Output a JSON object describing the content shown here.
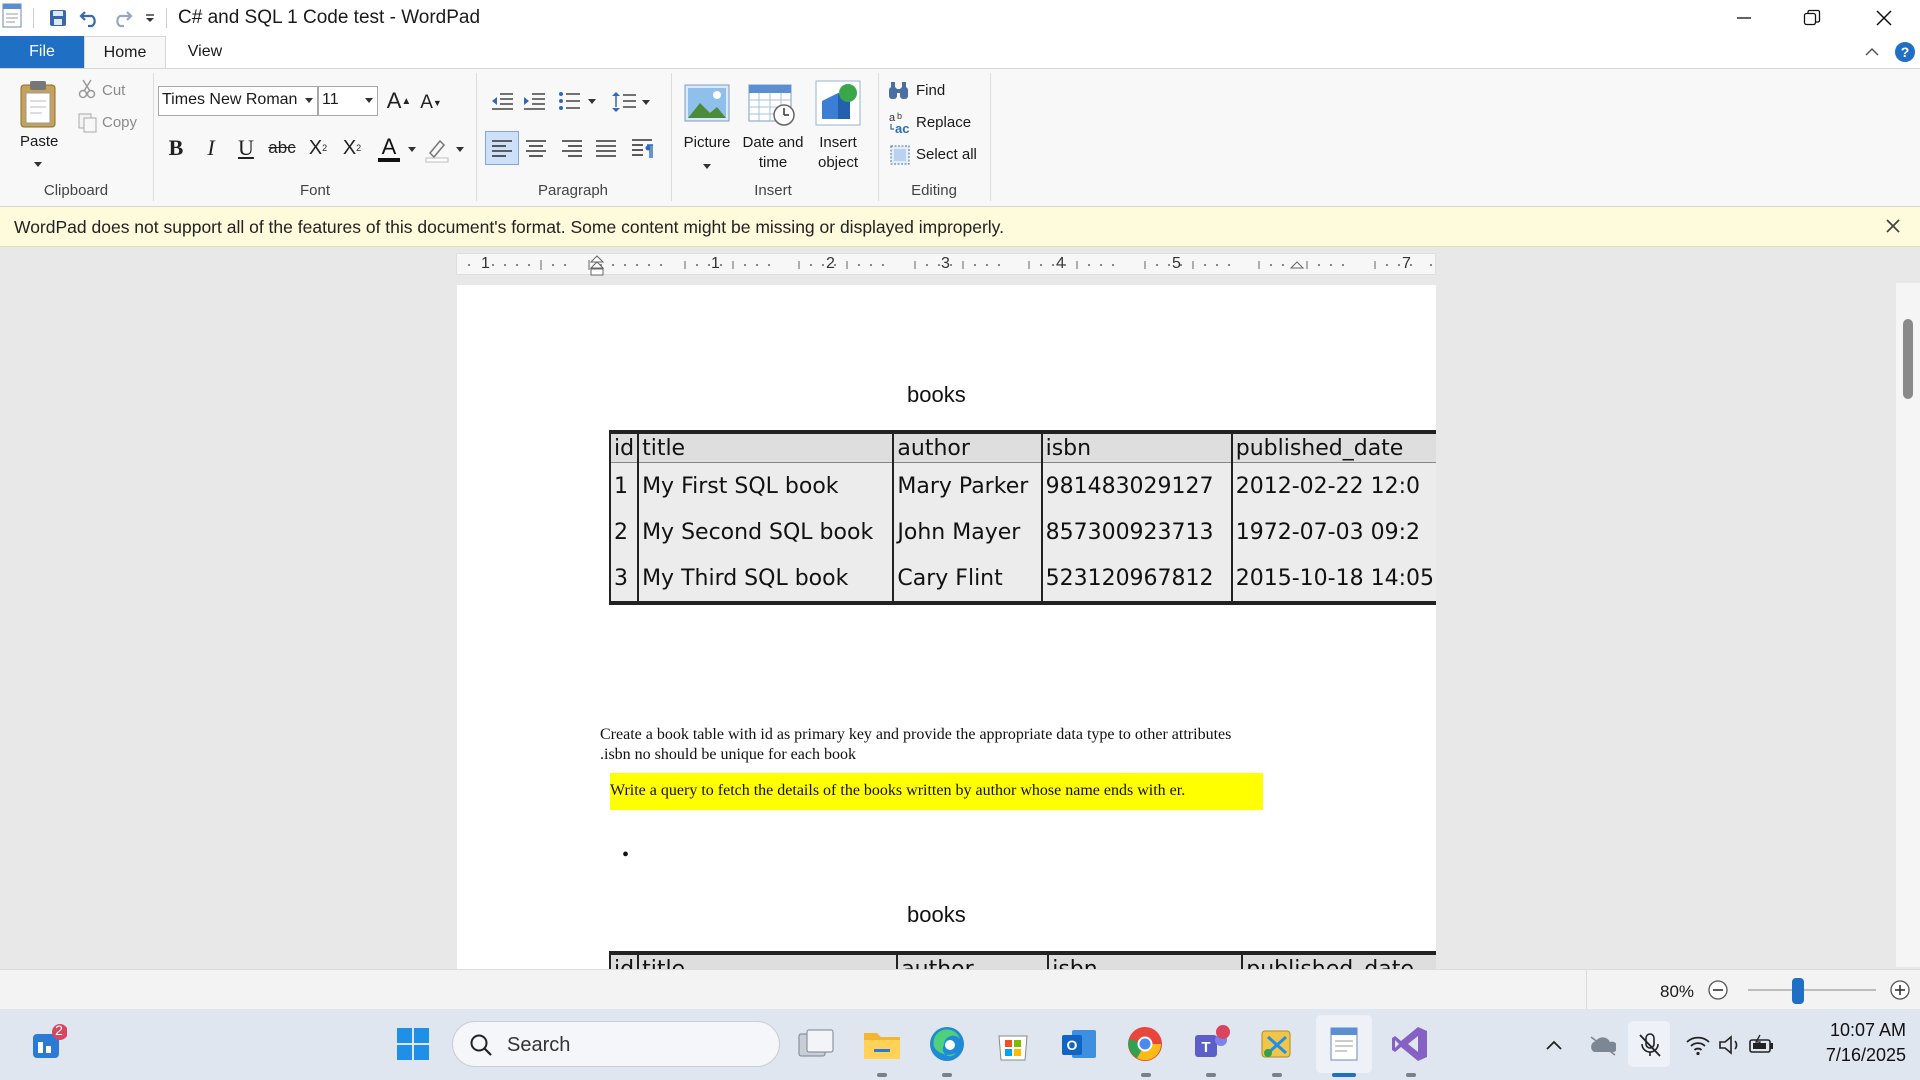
{
  "window": {
    "title": "C# and SQL 1 Code test - WordPad"
  },
  "tabs": {
    "file": "File",
    "home": "Home",
    "view": "View"
  },
  "ribbon": {
    "clipboard": {
      "paste": "Paste",
      "cut": "Cut",
      "copy": "Copy",
      "label": "Clipboard"
    },
    "font": {
      "family": "Times New Roman",
      "size": "11",
      "label": "Font"
    },
    "paragraph": {
      "label": "Paragraph"
    },
    "insert": {
      "picture": "Picture",
      "datetime_line1": "Date and",
      "datetime_line2": "time",
      "object_line1": "Insert",
      "object_line2": "object",
      "label": "Insert"
    },
    "editing": {
      "find": "Find",
      "replace": "Replace",
      "select_all": "Select all",
      "label": "Editing"
    }
  },
  "infobar": {
    "message": "WordPad does not support all of the features of this document's format. Some content might be missing or displayed improperly."
  },
  "ruler": {
    "numbers": [
      "1",
      "1",
      "2",
      "3",
      "4",
      "5",
      "7"
    ]
  },
  "document": {
    "heading1": "books",
    "table": {
      "headers": [
        "id",
        "title",
        "author",
        "isbn",
        "published_date"
      ],
      "rows": [
        [
          "1",
          "My First SQL book",
          "Mary Parker",
          "981483029127",
          "2012-02-22 12:0"
        ],
        [
          "2",
          "My Second SQL book",
          "John Mayer",
          "857300923713",
          "1972-07-03 09:2"
        ],
        [
          "3",
          "My Third SQL book",
          "Cary Flint",
          "523120967812",
          "2015-10-18 14:05"
        ]
      ]
    },
    "paragraph1": "Create a book table with id as primary key and provide the appropriate data type to other attributes .isbn no should be unique for each book",
    "highlighted": "Write a query to fetch the details of the books written by author whose name ends with er.",
    "bullet": "•",
    "heading2": "books",
    "table2_headers": [
      "id",
      "title",
      "author",
      "isbn",
      "published_date"
    ]
  },
  "status": {
    "zoom": "80%"
  },
  "taskbar": {
    "search": "Search",
    "widgets_badge": "2",
    "time": "10:07 AM",
    "date": "7/16/2025"
  },
  "colors": {
    "accent": "#1f6fc5",
    "highlight": "#ffff00",
    "infobar": "#fdfbdb"
  }
}
